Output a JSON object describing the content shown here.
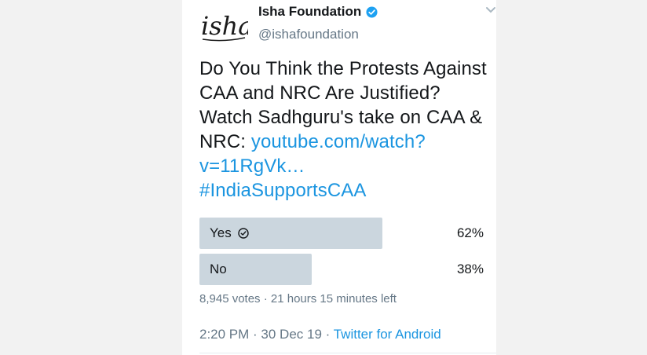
{
  "author": {
    "logo_text": "isha",
    "name": "Isha Foundation",
    "handle": "@ishafoundation",
    "verified_icon": "verified-badge-icon",
    "menu_icon": "chevron-down-icon"
  },
  "tweet": {
    "text_part1": "Do You Think the Protests Against CAA and NRC Are Justified? Watch Sadhguru's take on CAA & NRC: ",
    "link": "youtube.com/watch?v=11RgVk…",
    "hashtag": "#IndiaSupportsCAA"
  },
  "poll": {
    "options": [
      {
        "label": "Yes",
        "percent_text": "62%",
        "fraction": 0.62,
        "selected": true
      },
      {
        "label": "No",
        "percent_text": "38%",
        "fraction": 0.38,
        "selected": false
      }
    ],
    "meta": "8,945 votes · 21 hours 15 minutes left"
  },
  "footer": {
    "timestamp": "2:20 PM · 30 Dec 19 · ",
    "source": "Twitter for Android"
  },
  "colors": {
    "link": "#1b95e0",
    "bar": "#cbd6de",
    "muted": "#657786"
  }
}
